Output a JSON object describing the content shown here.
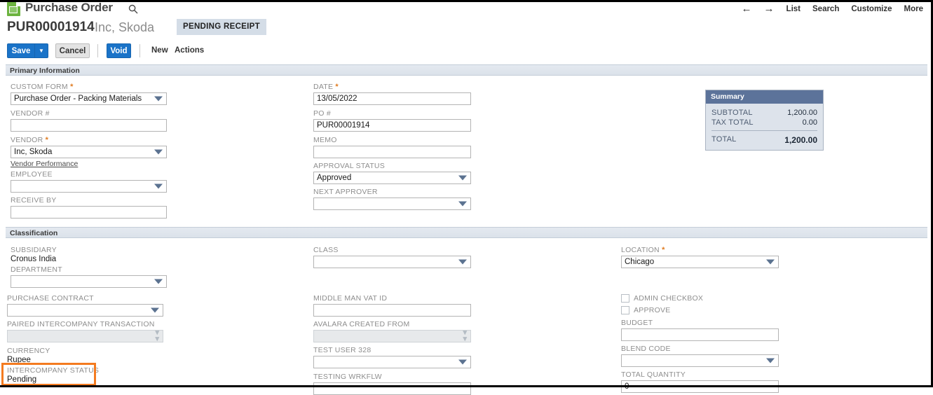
{
  "header": {
    "icon": "purchase-order-document-icon",
    "title": "Purchase Order",
    "search_icon": "search-icon",
    "record_id": "PUR00001914",
    "record_name": "Inc, Skoda",
    "status_badge": "PENDING RECEIPT",
    "nav": {
      "back_icon": "arrow-left-icon",
      "forward_icon": "arrow-right-icon",
      "links": [
        "List",
        "Search",
        "Customize",
        "More"
      ]
    }
  },
  "toolbar": {
    "save_label": "Save",
    "save_dropdown_icon": "chevron-down-icon",
    "cancel_label": "Cancel",
    "void_label": "Void",
    "new_label": "New",
    "actions_label": "Actions"
  },
  "sections": {
    "primary": {
      "title": "Primary Information"
    },
    "classification": {
      "title": "Classification"
    }
  },
  "primary": {
    "custom_form": {
      "label": "CUSTOM FORM",
      "required": true,
      "value": "Purchase Order - Packing Materials"
    },
    "vendor_num": {
      "label": "VENDOR #",
      "required": false,
      "value": ""
    },
    "vendor": {
      "label": "VENDOR",
      "required": true,
      "value": "Inc, Skoda"
    },
    "vendor_performance_link": "Vendor Performance",
    "employee": {
      "label": "EMPLOYEE",
      "required": false,
      "value": ""
    },
    "receive_by": {
      "label": "RECEIVE BY",
      "required": false,
      "value": ""
    },
    "date": {
      "label": "DATE",
      "required": true,
      "value": "13/05/2022"
    },
    "po_num": {
      "label": "PO #",
      "required": false,
      "value": "PUR00001914"
    },
    "memo": {
      "label": "MEMO",
      "required": false,
      "value": ""
    },
    "approval_status": {
      "label": "APPROVAL STATUS",
      "required": false,
      "value": "Approved"
    },
    "next_approver": {
      "label": "NEXT APPROVER",
      "required": false,
      "value": ""
    }
  },
  "summary": {
    "title": "Summary",
    "rows": [
      {
        "label": "SUBTOTAL",
        "value": "1,200.00"
      },
      {
        "label": "TAX TOTAL",
        "value": "0.00"
      }
    ],
    "total": {
      "label": "TOTAL",
      "value": "1,200.00"
    }
  },
  "classification": {
    "subsidiary": {
      "label": "SUBSIDIARY",
      "value": "Cronus India"
    },
    "department": {
      "label": "DEPARTMENT",
      "value": ""
    },
    "purchase_contract": {
      "label": "PURCHASE CONTRACT",
      "value": ""
    },
    "paired_intercompany_transaction": {
      "label": "PAIRED INTERCOMPANY TRANSACTION",
      "value": ""
    },
    "currency": {
      "label": "CURRENCY",
      "value": "Rupee"
    },
    "intercompany_status": {
      "label": "INTERCOMPANY STATUS",
      "value": "Pending"
    },
    "class": {
      "label": "CLASS",
      "value": ""
    },
    "middle_man_vat_id": {
      "label": "MIDDLE MAN VAT ID",
      "value": ""
    },
    "avalara_created_from": {
      "label": "AVALARA CREATED FROM",
      "value": ""
    },
    "test_user_328": {
      "label": "TEST USER 328",
      "value": ""
    },
    "testing_wrkflw": {
      "label": "TESTING WRKFLW",
      "value": ""
    },
    "location": {
      "label": "LOCATION",
      "required": true,
      "value": "Chicago"
    },
    "admin_checkbox": {
      "label": "ADMIN CHECKBOX",
      "checked": false
    },
    "approve": {
      "label": "APPROVE",
      "checked": false
    },
    "budget": {
      "label": "BUDGET",
      "value": ""
    },
    "blend_code": {
      "label": "BLEND CODE",
      "value": ""
    },
    "total_quantity": {
      "label": "TOTAL QUANTITY",
      "value": "0"
    }
  },
  "colors": {
    "accent_blue": "#1a73c8",
    "highlight_orange": "#f47b20",
    "summary_header": "#5c739a",
    "icon_green": "#6cb33f"
  }
}
